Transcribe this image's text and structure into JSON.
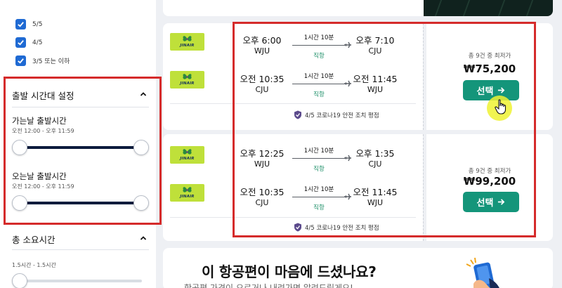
{
  "sidebar": {
    "ratings": [
      {
        "label": "5/5",
        "checked": true
      },
      {
        "label": "4/5",
        "checked": true
      },
      {
        "label": "3/5 또는 이하",
        "checked": true
      }
    ],
    "departure_time": {
      "title": "출발 시간대 설정",
      "outbound": {
        "title": "가는날 출발시간",
        "range": "오전 12:00 - 오후 11:59"
      },
      "inbound": {
        "title": "오는날 출발시간",
        "range": "오전 12:00 - 오후 11:59"
      }
    },
    "duration": {
      "title": "총 소요시간",
      "range": "1.5시간 - 1.5시간"
    }
  },
  "flights": [
    {
      "legs": [
        {
          "airline": "JINAIR",
          "depart_time": "오후 6:00",
          "depart_airport": "WJU",
          "duration": "1시간 10분",
          "stops": "직항",
          "arrive_time": "오후 7:10",
          "arrive_airport": "CJU"
        },
        {
          "airline": "JINAIR",
          "depart_time": "오전 10:35",
          "depart_airport": "CJU",
          "duration": "1시간 10분",
          "stops": "직항",
          "arrive_time": "오전 11:45",
          "arrive_airport": "WJU"
        }
      ],
      "covid_rating": "4/5 코로나19 안전 조치 평점",
      "deal_count": "총 9건 중 최저가",
      "price": "₩75,200",
      "select_label": "선택"
    },
    {
      "legs": [
        {
          "airline": "JINAIR",
          "depart_time": "오후 12:25",
          "depart_airport": "WJU",
          "duration": "1시간 10분",
          "stops": "직항",
          "arrive_time": "오후 1:35",
          "arrive_airport": "CJU"
        },
        {
          "airline": "JINAIR",
          "depart_time": "오전 10:35",
          "depart_airport": "CJU",
          "duration": "1시간 10분",
          "stops": "직항",
          "arrive_time": "오전 11:45",
          "arrive_airport": "WJU"
        }
      ],
      "covid_rating": "4/5 코로나19 안전 조치 평점",
      "deal_count": "총 9건 중 최저가",
      "price": "₩99,200",
      "select_label": "선택"
    }
  ],
  "feedback": {
    "title": "이 항공편이 마음에 드셨나요?",
    "subtitle": "항공편 가격이 오르거나 내려가면 알려드릴게요!"
  },
  "colors": {
    "checkbox": "#1f6ad3",
    "slider_track": "#0c1c3d",
    "select_button": "#14957a",
    "direct_text": "#1d8f68",
    "annotation_box": "#d52b2b",
    "airline_logo": "#bfe03a"
  }
}
